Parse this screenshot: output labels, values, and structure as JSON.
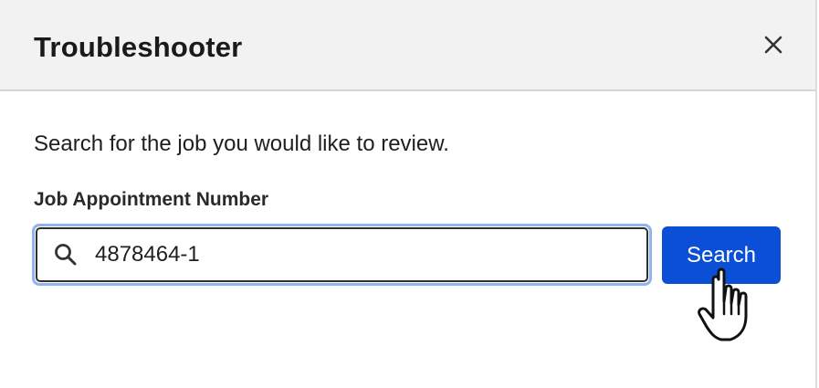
{
  "dialog": {
    "title": "Troubleshooter",
    "close_icon": "close-icon"
  },
  "main": {
    "intro_text": "Search for the job you would like to review.",
    "field_label": "Job Appointment Number",
    "search": {
      "icon": "search-icon",
      "value": "4878464-1",
      "placeholder": ""
    },
    "search_button_label": "Search"
  },
  "colors": {
    "header_bg": "#f2f2f2",
    "accent": "#0a4fd6",
    "focus_ring": "#8fb4f0"
  },
  "cursor": {
    "icon": "hand-pointer-icon"
  }
}
